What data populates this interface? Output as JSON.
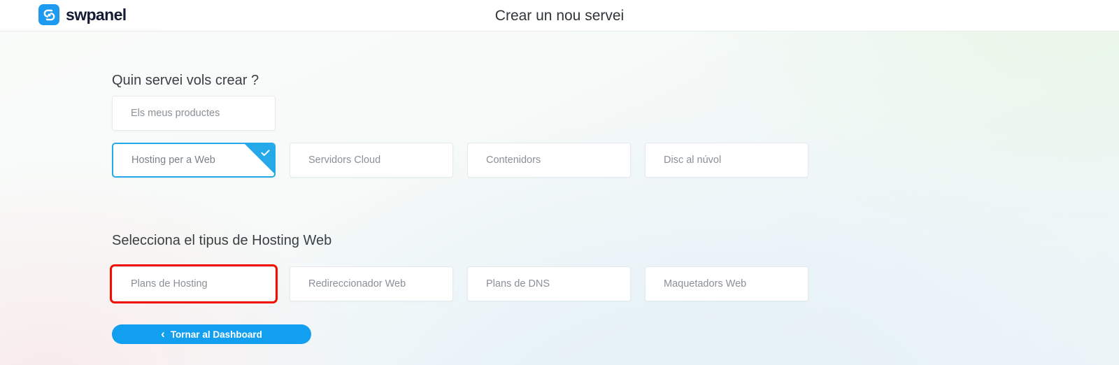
{
  "header": {
    "logo_icon": "swpanel-logo-icon",
    "logo_text": "swpanel",
    "title": "Crear un nou servei"
  },
  "sections": [
    {
      "heading": "Quin servei vols crear ?",
      "product_row": [
        {
          "label": "Els meus productes",
          "selected": false
        }
      ],
      "service_row": [
        {
          "label": "Hosting per a Web",
          "selected": true
        },
        {
          "label": "Servidors Cloud",
          "selected": false
        },
        {
          "label": "Contenidors",
          "selected": false
        },
        {
          "label": "Disc al núvol",
          "selected": false
        }
      ]
    },
    {
      "heading": "Selecciona el tipus de Hosting Web",
      "hosting_row": [
        {
          "label": "Plans de Hosting",
          "selected": false,
          "annotated": true
        },
        {
          "label": "Redireccionador Web",
          "selected": false,
          "annotated": false
        },
        {
          "label": "Plans de DNS",
          "selected": false,
          "annotated": false
        },
        {
          "label": "Maquetadors Web",
          "selected": false,
          "annotated": false
        }
      ]
    }
  ],
  "footer": {
    "back_label": "Tornar al Dashboard",
    "back_chevron": "‹"
  },
  "icons": {
    "check": "check-icon",
    "chevron_left": "chevron-left-icon"
  },
  "colors": {
    "brand_blue": "#139ff0",
    "selected_border": "#26a9e8",
    "annotation_red": "#f30c00",
    "card_border": "#e6eaec",
    "card_text": "#8a9096",
    "heading_text": "#3a3f44"
  }
}
